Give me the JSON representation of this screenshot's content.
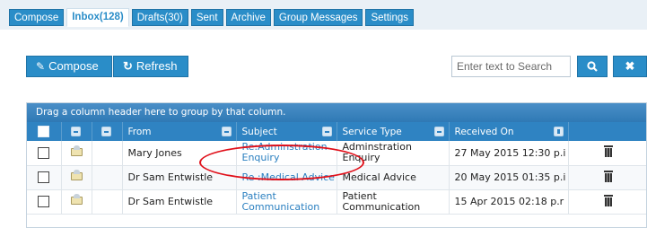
{
  "tabs": [
    "Compose",
    "Inbox(128)",
    "Drafts(30)",
    "Sent",
    "Archive",
    "Group Messages",
    "Settings"
  ],
  "active_tab": "Inbox(128)",
  "toolbar": {
    "compose_label": "Compose",
    "refresh_label": "Refresh",
    "search_placeholder": "Enter text to Search",
    "search_icon": "search-icon",
    "clear_icon": "close-icon"
  },
  "grid": {
    "group_hint": "Drag a column header here to group by that column.",
    "columns": [
      "From",
      "Subject",
      "Service Type",
      "Received On"
    ],
    "rows": [
      {
        "from": "Mary Jones",
        "subject": "Re:Adminstration Enquiry",
        "service_type": "Adminstration Enquiry",
        "received_on": "27 May 2015 12:30 p.i"
      },
      {
        "from": "Dr Sam Entwistle",
        "subject": "Re :Medical Advice",
        "service_type": "Medical Advice",
        "received_on": "20 May 2015 01:35 p.i"
      },
      {
        "from": "Dr Sam Entwistle",
        "subject": "Patient Communication",
        "service_type": "Patient Communication",
        "received_on": "15 Apr 2015 02:18 p.r"
      }
    ]
  },
  "colors": {
    "accent": "#2a8dc8",
    "header": "#2f83c2",
    "annotation": "#e0101a"
  }
}
